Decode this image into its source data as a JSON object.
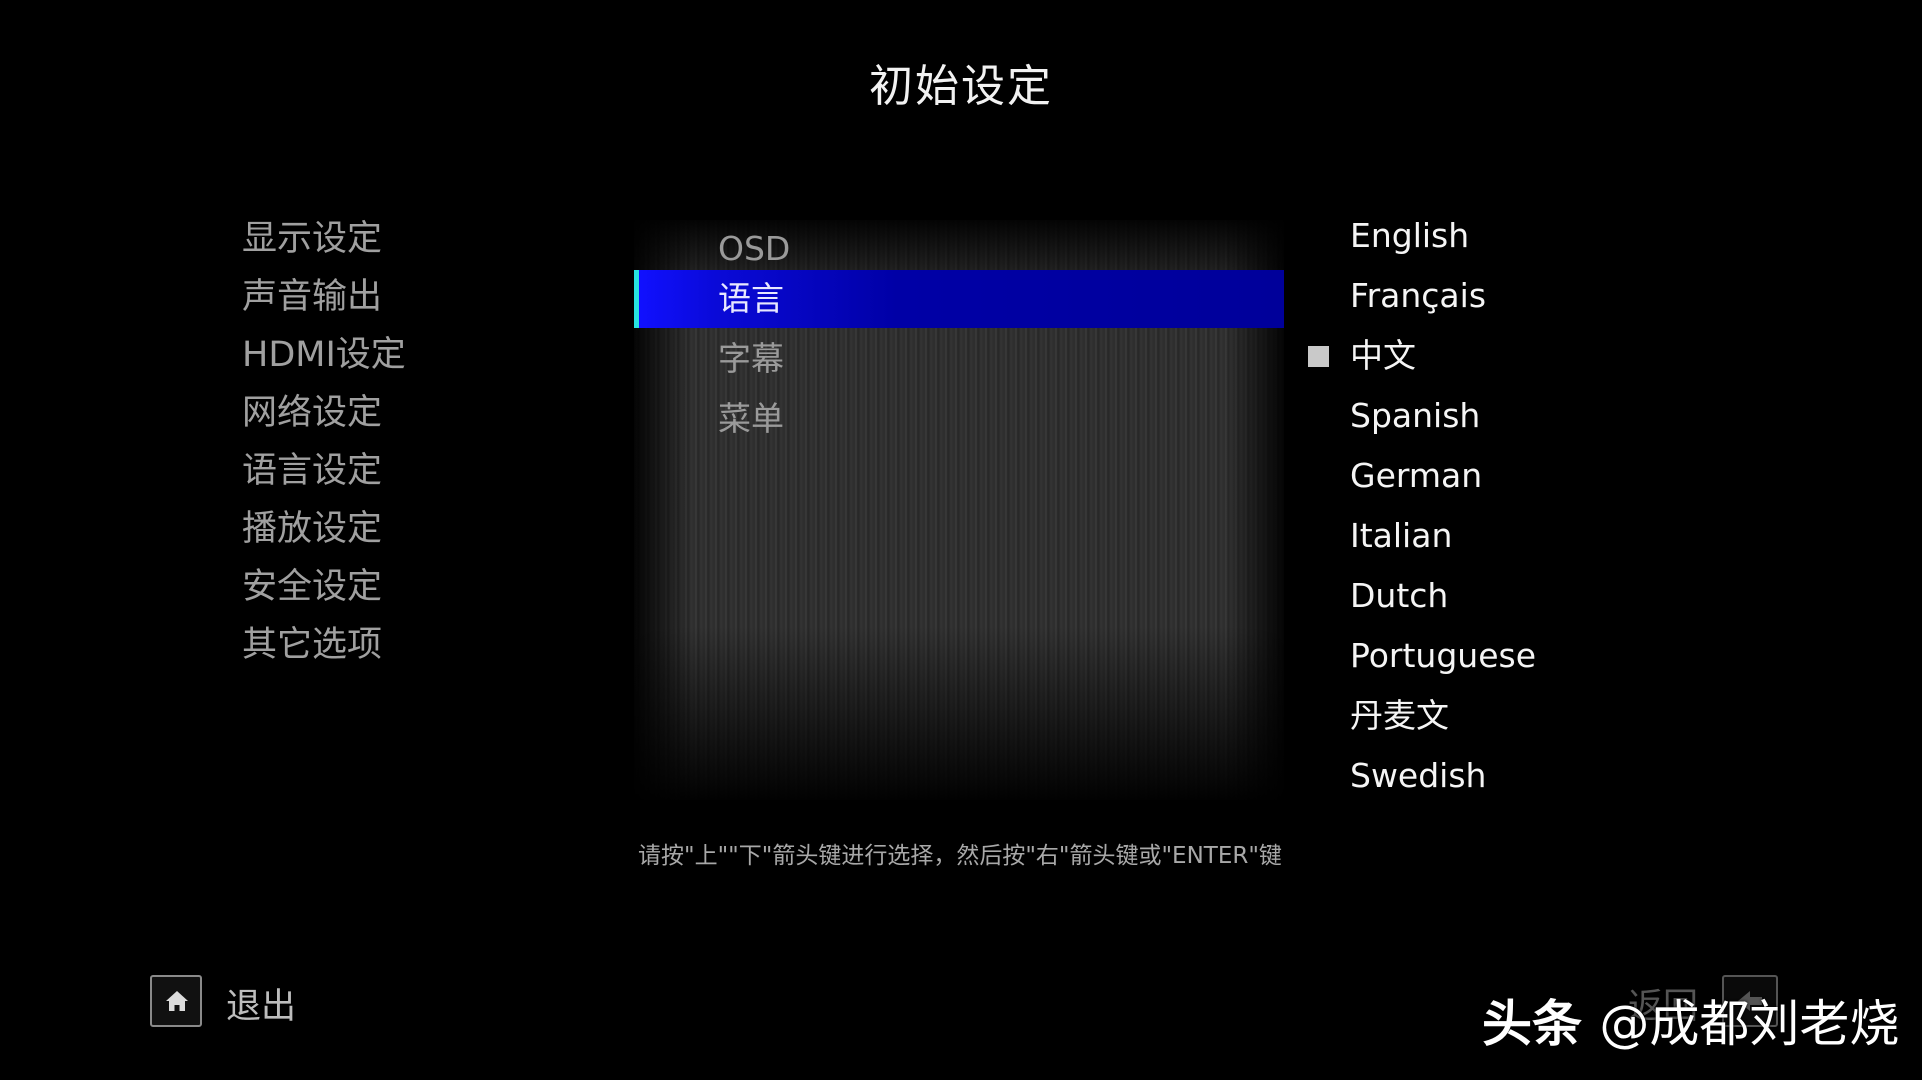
{
  "title": "初始设定",
  "categories": [
    {
      "label": "显示设定"
    },
    {
      "label": "声音输出"
    },
    {
      "label": "HDMI设定"
    },
    {
      "label": "网络设定"
    },
    {
      "label": "语言设定"
    },
    {
      "label": "播放设定"
    },
    {
      "label": "安全设定"
    },
    {
      "label": "其它选项"
    }
  ],
  "sub_menu": [
    {
      "label": "OSD"
    },
    {
      "label": "语言",
      "selected": true
    },
    {
      "label": "字幕"
    },
    {
      "label": "菜单"
    }
  ],
  "languages": [
    {
      "label": "English"
    },
    {
      "label": "Français"
    },
    {
      "label": "中文",
      "current": true
    },
    {
      "label": "Spanish"
    },
    {
      "label": "German"
    },
    {
      "label": "Italian"
    },
    {
      "label": "Dutch"
    },
    {
      "label": "Portuguese"
    },
    {
      "label": "丹麦文"
    },
    {
      "label": "Swedish"
    }
  ],
  "hint": "请按\"上\"\"下\"箭头键进行选择，然后按\"右\"箭头键或\"ENTER\"键",
  "footer": {
    "exit_label": "退出",
    "home_icon": "home-icon",
    "back_label": "返回",
    "back_icon": "back-arrow-icon"
  },
  "watermark": {
    "brand": "头条",
    "handle": "@成都刘老烧"
  },
  "colors": {
    "highlight": "#0000a6",
    "highlight_edge": "#27e3e0",
    "background": "#000000"
  }
}
